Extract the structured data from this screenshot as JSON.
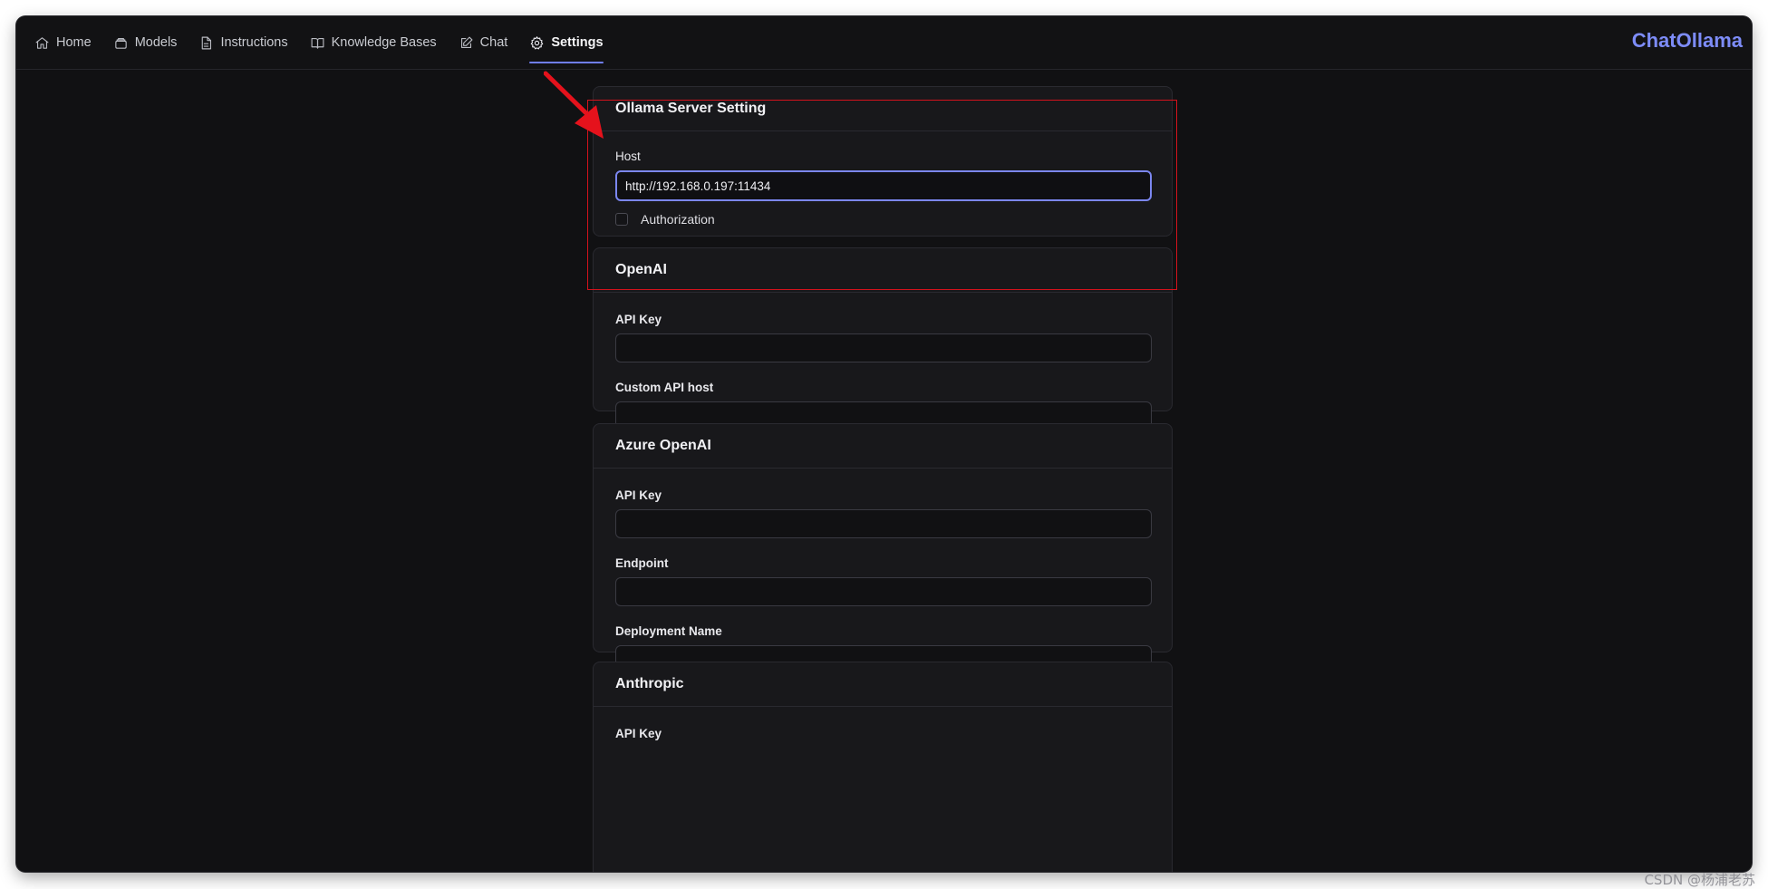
{
  "nav": {
    "items": [
      {
        "label": "Home",
        "icon": "home-icon"
      },
      {
        "label": "Models",
        "icon": "layers-icon"
      },
      {
        "label": "Instructions",
        "icon": "document-icon"
      },
      {
        "label": "Knowledge Bases",
        "icon": "book-open-icon"
      },
      {
        "label": "Chat",
        "icon": "pencil-square-icon"
      },
      {
        "label": "Settings",
        "icon": "gear-icon"
      }
    ],
    "active": "Settings",
    "active_color": "#6f7ef5"
  },
  "brand": {
    "title": "ChatOllama",
    "color": "#7d8cf8"
  },
  "ollama": {
    "title": "Ollama Server Setting",
    "host_label": "Host",
    "host_value": "http://192.168.0.197:11434",
    "auth_label": "Authorization"
  },
  "openai": {
    "title": "OpenAI",
    "api_key_label": "API Key",
    "api_key_value": "",
    "custom_host_label": "Custom API host",
    "custom_host_value": ""
  },
  "azure": {
    "title": "Azure OpenAI",
    "api_key_label": "API Key",
    "api_key_value": "",
    "endpoint_label": "Endpoint",
    "endpoint_value": "",
    "deployment_label": "Deployment Name",
    "deployment_value": ""
  },
  "anthropic": {
    "title": "Anthropic",
    "api_key_label": "API Key"
  },
  "annotation": {
    "highlight_color": "#d3121c"
  },
  "watermark": "CSDN @杨浦老苏"
}
